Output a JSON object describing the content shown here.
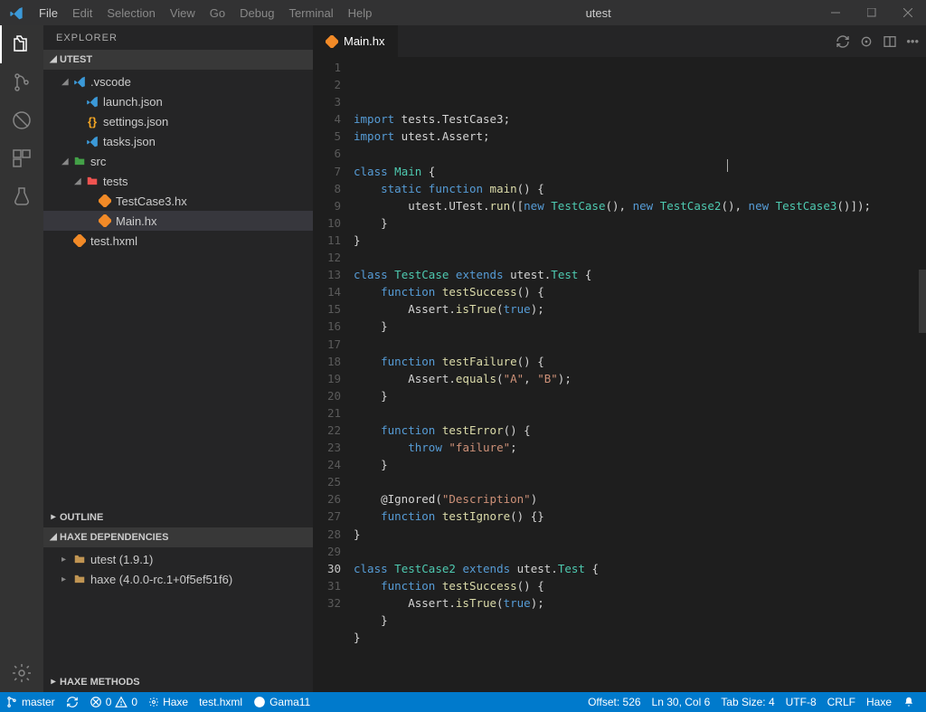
{
  "window": {
    "title": "utest"
  },
  "menu": [
    "File",
    "Edit",
    "Selection",
    "View",
    "Go",
    "Debug",
    "Terminal",
    "Help"
  ],
  "sidebar": {
    "title": "EXPLORER",
    "sections": {
      "workspace_label": "UTEST",
      "outline_label": "OUTLINE",
      "haxedeps_label": "HAXE DEPENDENCIES",
      "haxemethods_label": "HAXE METHODS"
    },
    "tree": {
      "vscode": ".vscode",
      "launch": "launch.json",
      "settings": "settings.json",
      "tasks": "tasks.json",
      "src": "src",
      "tests": "tests",
      "testcase3": "TestCase3.hx",
      "mainhx": "Main.hx",
      "testhxml": "test.hxml"
    },
    "deps": {
      "utest": "utest (1.9.1)",
      "haxe": "haxe (4.0.0-rc.1+0f5ef51f6)"
    }
  },
  "tab": {
    "label": "Main.hx"
  },
  "editor": {
    "lines": 32,
    "current_line": 30,
    "code": [
      [
        [
          "kw",
          "import"
        ],
        [
          "",
          ""
        ],
        [
          "",
          " tests.TestCase3;"
        ]
      ],
      [
        [
          "kw",
          "import"
        ],
        [
          "",
          " utest.Assert;"
        ]
      ],
      [],
      [
        [
          "kw",
          "class"
        ],
        [
          "",
          " "
        ],
        [
          "type",
          "Main"
        ],
        [
          "",
          " {"
        ]
      ],
      [
        [
          "",
          "    "
        ],
        [
          "kw",
          "static"
        ],
        [
          "",
          " "
        ],
        [
          "kw",
          "function"
        ],
        [
          "",
          " "
        ],
        [
          "fn",
          "main"
        ],
        [
          "",
          "() {"
        ]
      ],
      [
        [
          "",
          "        utest.UTest."
        ],
        [
          "fn",
          "run"
        ],
        [
          "",
          "(["
        ],
        [
          "kw",
          "new"
        ],
        [
          "",
          " "
        ],
        [
          "type",
          "TestCase"
        ],
        [
          "",
          "(), "
        ],
        [
          "kw",
          "new"
        ],
        [
          "",
          " "
        ],
        [
          "type",
          "TestCase2"
        ],
        [
          "",
          "(), "
        ],
        [
          "kw",
          "new"
        ],
        [
          "",
          " "
        ],
        [
          "type",
          "TestCase3"
        ],
        [
          "",
          "()]);"
        ]
      ],
      [
        [
          "",
          "    }"
        ]
      ],
      [
        [
          "",
          "}"
        ]
      ],
      [],
      [
        [
          "kw",
          "class"
        ],
        [
          "",
          " "
        ],
        [
          "type",
          "TestCase"
        ],
        [
          "",
          " "
        ],
        [
          "kw",
          "extends"
        ],
        [
          "",
          " utest."
        ],
        [
          "type",
          "Test"
        ],
        [
          "",
          " {"
        ]
      ],
      [
        [
          "",
          "    "
        ],
        [
          "kw",
          "function"
        ],
        [
          "",
          " "
        ],
        [
          "fn",
          "testSuccess"
        ],
        [
          "",
          "() {"
        ]
      ],
      [
        [
          "",
          "        Assert."
        ],
        [
          "fn",
          "isTrue"
        ],
        [
          "",
          "("
        ],
        [
          "const",
          "true"
        ],
        [
          "",
          ");"
        ]
      ],
      [
        [
          "",
          "    }"
        ]
      ],
      [],
      [
        [
          "",
          "    "
        ],
        [
          "kw",
          "function"
        ],
        [
          "",
          " "
        ],
        [
          "fn",
          "testFailure"
        ],
        [
          "",
          "() {"
        ]
      ],
      [
        [
          "",
          "        Assert."
        ],
        [
          "fn",
          "equals"
        ],
        [
          "",
          "("
        ],
        [
          "str",
          "\"A\""
        ],
        [
          "",
          ", "
        ],
        [
          "str",
          "\"B\""
        ],
        [
          "",
          ");"
        ]
      ],
      [
        [
          "",
          "    }"
        ]
      ],
      [],
      [
        [
          "",
          "    "
        ],
        [
          "kw",
          "function"
        ],
        [
          "",
          " "
        ],
        [
          "fn",
          "testError"
        ],
        [
          "",
          "() {"
        ]
      ],
      [
        [
          "",
          "        "
        ],
        [
          "kw",
          "throw"
        ],
        [
          "",
          " "
        ],
        [
          "str",
          "\"failure\""
        ],
        [
          "",
          ";"
        ]
      ],
      [
        [
          "",
          "    }"
        ]
      ],
      [],
      [
        [
          "",
          "    "
        ],
        [
          "decor",
          "@Ignored"
        ],
        [
          "",
          "("
        ],
        [
          "str",
          "\"Description\""
        ],
        [
          "",
          ")"
        ]
      ],
      [
        [
          "",
          "    "
        ],
        [
          "kw",
          "function"
        ],
        [
          "",
          " "
        ],
        [
          "fn",
          "testIgnore"
        ],
        [
          "",
          "() {}"
        ]
      ],
      [
        [
          "",
          "}"
        ]
      ],
      [],
      [
        [
          "kw",
          "class"
        ],
        [
          "",
          " "
        ],
        [
          "type",
          "TestCase2"
        ],
        [
          "",
          " "
        ],
        [
          "kw",
          "extends"
        ],
        [
          "",
          " utest."
        ],
        [
          "type",
          "Test"
        ],
        [
          "",
          " {"
        ]
      ],
      [
        [
          "",
          "    "
        ],
        [
          "kw",
          "function"
        ],
        [
          "",
          " "
        ],
        [
          "fn",
          "testSuccess"
        ],
        [
          "",
          "() {"
        ]
      ],
      [
        [
          "",
          "        Assert."
        ],
        [
          "fn",
          "isTrue"
        ],
        [
          "",
          "("
        ],
        [
          "const",
          "true"
        ],
        [
          "",
          ");"
        ]
      ],
      [
        [
          "",
          "    }"
        ]
      ],
      [
        [
          "",
          "}"
        ]
      ],
      []
    ]
  },
  "status": {
    "branch": "master",
    "sync": "",
    "errors": "0",
    "warnings": "0",
    "haxe": "Haxe",
    "hxml": "test.hxml",
    "user": "Gama11",
    "offset": "Offset: 526",
    "lncol": "Ln 30, Col 6",
    "tabsize": "Tab Size: 4",
    "encoding": "UTF-8",
    "eol": "CRLF",
    "lang": "Haxe"
  }
}
